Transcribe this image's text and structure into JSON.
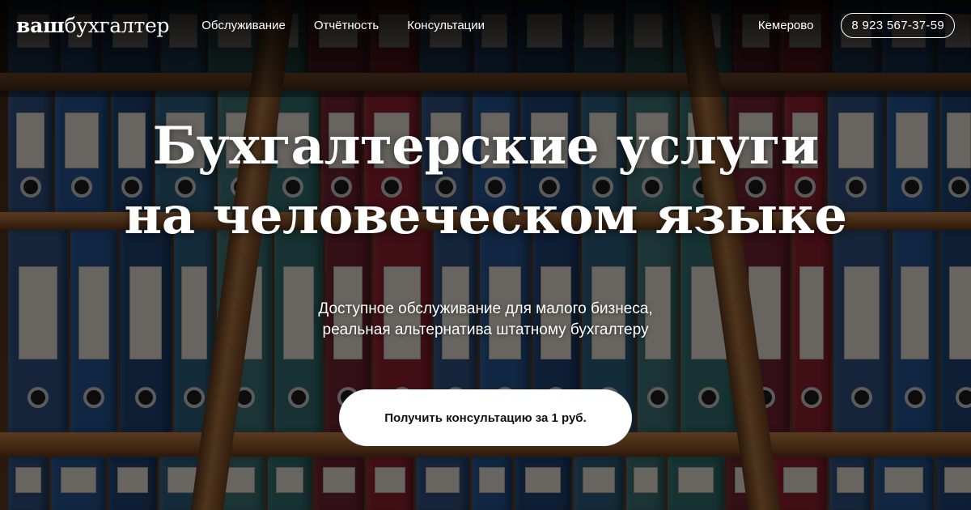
{
  "header": {
    "logo_bold": "ваш",
    "logo_light": "бухгалтер",
    "nav": [
      {
        "label": "Обслуживание"
      },
      {
        "label": "Отчётность"
      },
      {
        "label": "Консультации"
      }
    ],
    "city": "Кемерово",
    "phone": "8 923 567-37-59"
  },
  "hero": {
    "title_line1": "Бухгалтерские услуги",
    "title_line2": "на человеческом языке",
    "subtitle_line1": "Доступное обслуживание для малого бизнеса,",
    "subtitle_line2": "реальная альтернатива штатному бухгалтеру",
    "cta_label": "Получить консультацию за 1 руб."
  },
  "colors": {
    "accent": "#ffffff",
    "binders": [
      "#2c4d7a",
      "#2f6a6a",
      "#1e3f6e",
      "#8a1f2e",
      "#3a6d70",
      "#23508a",
      "#6b2030",
      "#2a5a78"
    ]
  }
}
